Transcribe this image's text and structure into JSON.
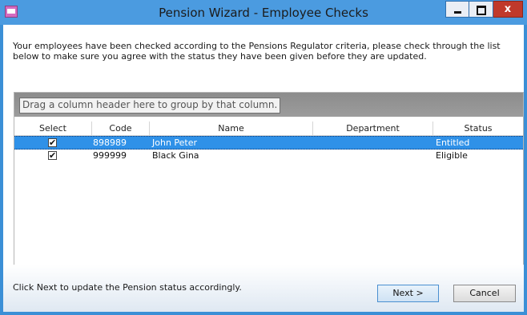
{
  "window": {
    "title": "Pension Wizard - Employee Checks",
    "close_glyph": "x"
  },
  "intro": {
    "text": "Your employees have been checked according to the Pensions Regulator criteria, please check through the list below to make sure you agree with the status they have been given before they are updated."
  },
  "grid": {
    "group_prompt": "Drag a column header here to group by that column.",
    "columns": [
      "Select",
      "Code",
      "Name",
      "Department",
      "Status"
    ],
    "rows": [
      {
        "checked": "✔",
        "code": "898989",
        "name": "John Peter",
        "department": "",
        "status": "Entitled",
        "selected": true
      },
      {
        "checked": "✔",
        "code": "999999",
        "name": "Black Gina",
        "department": "",
        "status": "Eligible",
        "selected": false
      }
    ]
  },
  "footer": {
    "message": "Click Next to update the Pension status accordingly.",
    "next_label": "Next >",
    "cancel_label": "Cancel"
  },
  "colors": {
    "title_bar": "#4b9be0",
    "selection": "#2f91e8",
    "close_button": "#c0392b"
  }
}
